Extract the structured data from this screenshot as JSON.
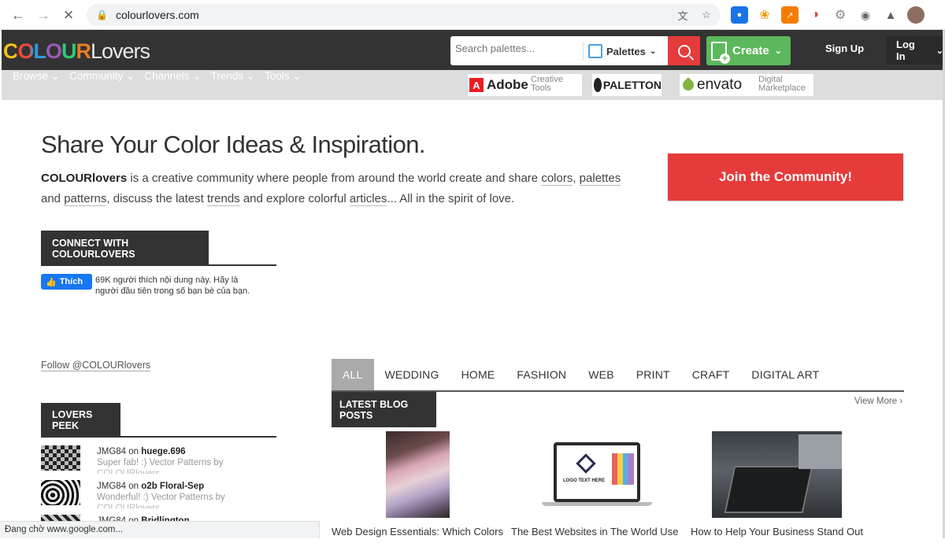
{
  "browser": {
    "url": "colourlovers.com",
    "status": "Đang chờ www.google.com..."
  },
  "header": {
    "logo_colour": "COLOUR",
    "logo_lovers": "Lovers",
    "search_placeholder": "Search palettes...",
    "search_type": "Palettes",
    "create_label": "Create",
    "signup_label": "Sign Up",
    "login_label": "Log In"
  },
  "subnav": {
    "items": [
      {
        "label": "Browse"
      },
      {
        "label": "Community"
      },
      {
        "label": "Channels"
      },
      {
        "label": "Trends"
      },
      {
        "label": "Tools"
      }
    ],
    "sponsors": {
      "adobe": "Adobe",
      "adobe_sub1": "Creative",
      "adobe_sub2": "Tools",
      "paletton": "PALETTON",
      "envato": "envato",
      "envato_sub1": "Digital",
      "envato_sub2": "Marketplace"
    }
  },
  "hero": {
    "title": "Share Your Color Ideas & Inspiration.",
    "brand": "COLOURlovers",
    "t1": " is a creative community where people from around the world create and share ",
    "colors": "colors",
    "t2": ", ",
    "palettes": "palettes",
    "t3": " and ",
    "patterns": "patterns",
    "t4": ", discuss the latest ",
    "trends": "trends",
    "t5": " and explore colorful ",
    "articles": "articles",
    "t6": "... All in the spirit of love.",
    "join_label": "Join the Community!"
  },
  "connect": {
    "heading": "CONNECT WITH COLOURLOVERS",
    "fb_like": "Thích",
    "fb_text": "69K người thích nội dung này. Hãy là người đầu tiên trong số bạn bè của bạn.",
    "follow": "Follow @COLOURlovers"
  },
  "peek": {
    "heading": "LOVERS PEEK",
    "items": [
      {
        "user": "JMG84",
        "on": "on",
        "title": "huege.696",
        "comment": "Super fab! :) Vector Patterns by",
        "more": "COLOURlovers"
      },
      {
        "user": "JMG84",
        "on": "on",
        "title": "o2b Floral-Sep",
        "comment": "Wonderful! :) Vector Patterns by",
        "more": "COLOURlovers"
      },
      {
        "user": "JMG84",
        "on": "on",
        "title": "Bridlington",
        "comment": "",
        "more": ""
      }
    ]
  },
  "categories": [
    "ALL",
    "WEDDING",
    "HOME",
    "FASHION",
    "WEB",
    "PRINT",
    "CRAFT",
    "DIGITAL ART"
  ],
  "blog": {
    "heading": "LATEST BLOG POSTS",
    "view_more": "View More ›",
    "posts": [
      {
        "title": "Web Design Essentials: Which Colors"
      },
      {
        "title": "The Best Websites in The World Use"
      },
      {
        "title": "How to Help Your Business Stand Out"
      }
    ],
    "laptop_screen_text": "LOGO TEXT HERE"
  },
  "colors": {
    "header_bg": "#333333",
    "subnav_bg": "#dddddd",
    "accent_red": "#e53b3b",
    "create_green": "#5cb85c"
  }
}
